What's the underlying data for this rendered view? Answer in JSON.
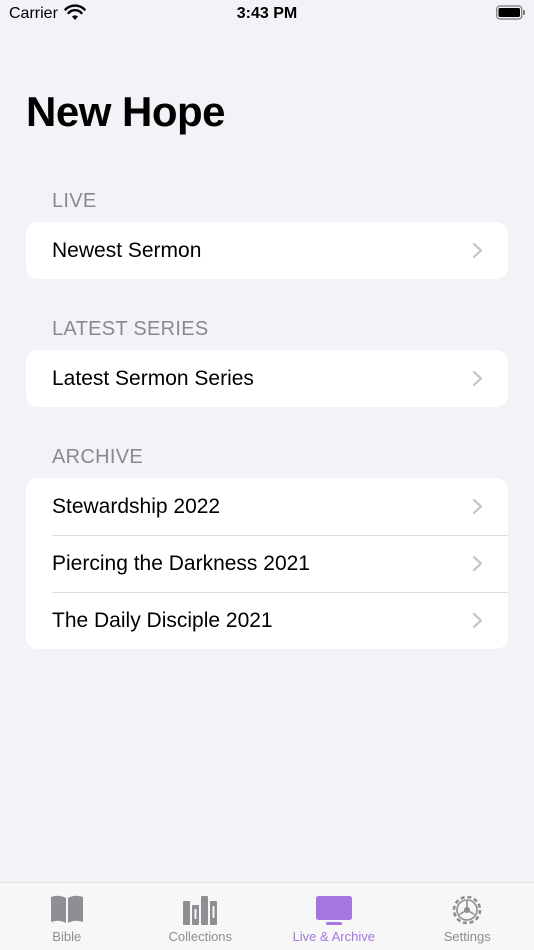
{
  "status_bar": {
    "carrier": "Carrier",
    "time": "3:43 PM"
  },
  "title": "New Hope",
  "sections": [
    {
      "header": "LIVE",
      "items": [
        "Newest Sermon"
      ]
    },
    {
      "header": "LATEST SERIES",
      "items": [
        "Latest Sermon Series"
      ]
    },
    {
      "header": "ARCHIVE",
      "items": [
        "Stewardship 2022",
        "Piercing the Darkness 2021",
        "The Daily Disciple 2021"
      ]
    }
  ],
  "tabs": [
    {
      "label": "Bible",
      "icon": "book-icon"
    },
    {
      "label": "Collections",
      "icon": "books-icon"
    },
    {
      "label": "Live & Archive",
      "icon": "tv-icon",
      "active": true
    },
    {
      "label": "Settings",
      "icon": "gear-icon"
    }
  ],
  "colors": {
    "accent": "#a477e0",
    "inactive": "#8e8e93",
    "background": "#f2f2f7"
  }
}
